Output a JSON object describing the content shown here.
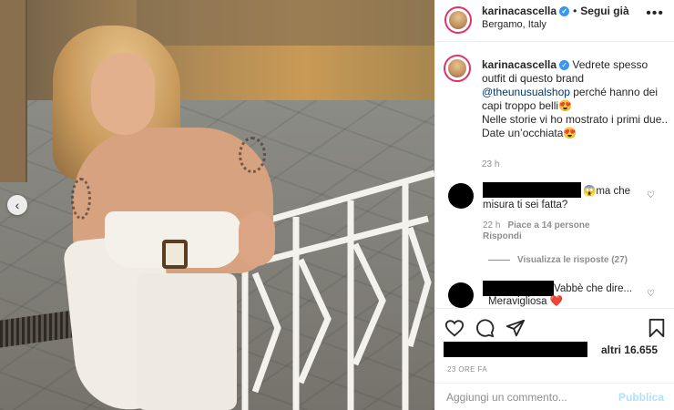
{
  "post": {
    "username": "karinacascella",
    "separator": "•",
    "follow_label": "Segui già",
    "location": "Bergamo, Italy",
    "more": "•••",
    "verified": "✓"
  },
  "caption": {
    "username": "karinacascella",
    "line1": " Vedrete spesso outfit di questo brand ",
    "mention": "@theunusualshop",
    "line2": " perché hanno dei capi troppo belli😍",
    "line3": "Nelle storie vi ho mostrato i primi due..",
    "line4": "Date un’occhiata😍",
    "time": "23 h"
  },
  "comments": [
    {
      "text_a": "😱ma che",
      "text_b": "misura ti sei fatta?",
      "time": "22 h",
      "likes": "Piace a 14 persone",
      "reply": "Rispondi"
    },
    {
      "text_a": "Vabbè che dire...",
      "text_b": "Meravigliosa ❤️"
    }
  ],
  "view_replies": "Visualizza le risposte (27)",
  "likes_text": "altri 16.655",
  "date": "23 ORE FA",
  "comment_placeholder": "Aggiungi un commento...",
  "publish_label": "Pubblica",
  "colors": {
    "accent": "#3897f0",
    "publish_disabled": "#b2dffc",
    "heart_red": "#ed4956"
  }
}
